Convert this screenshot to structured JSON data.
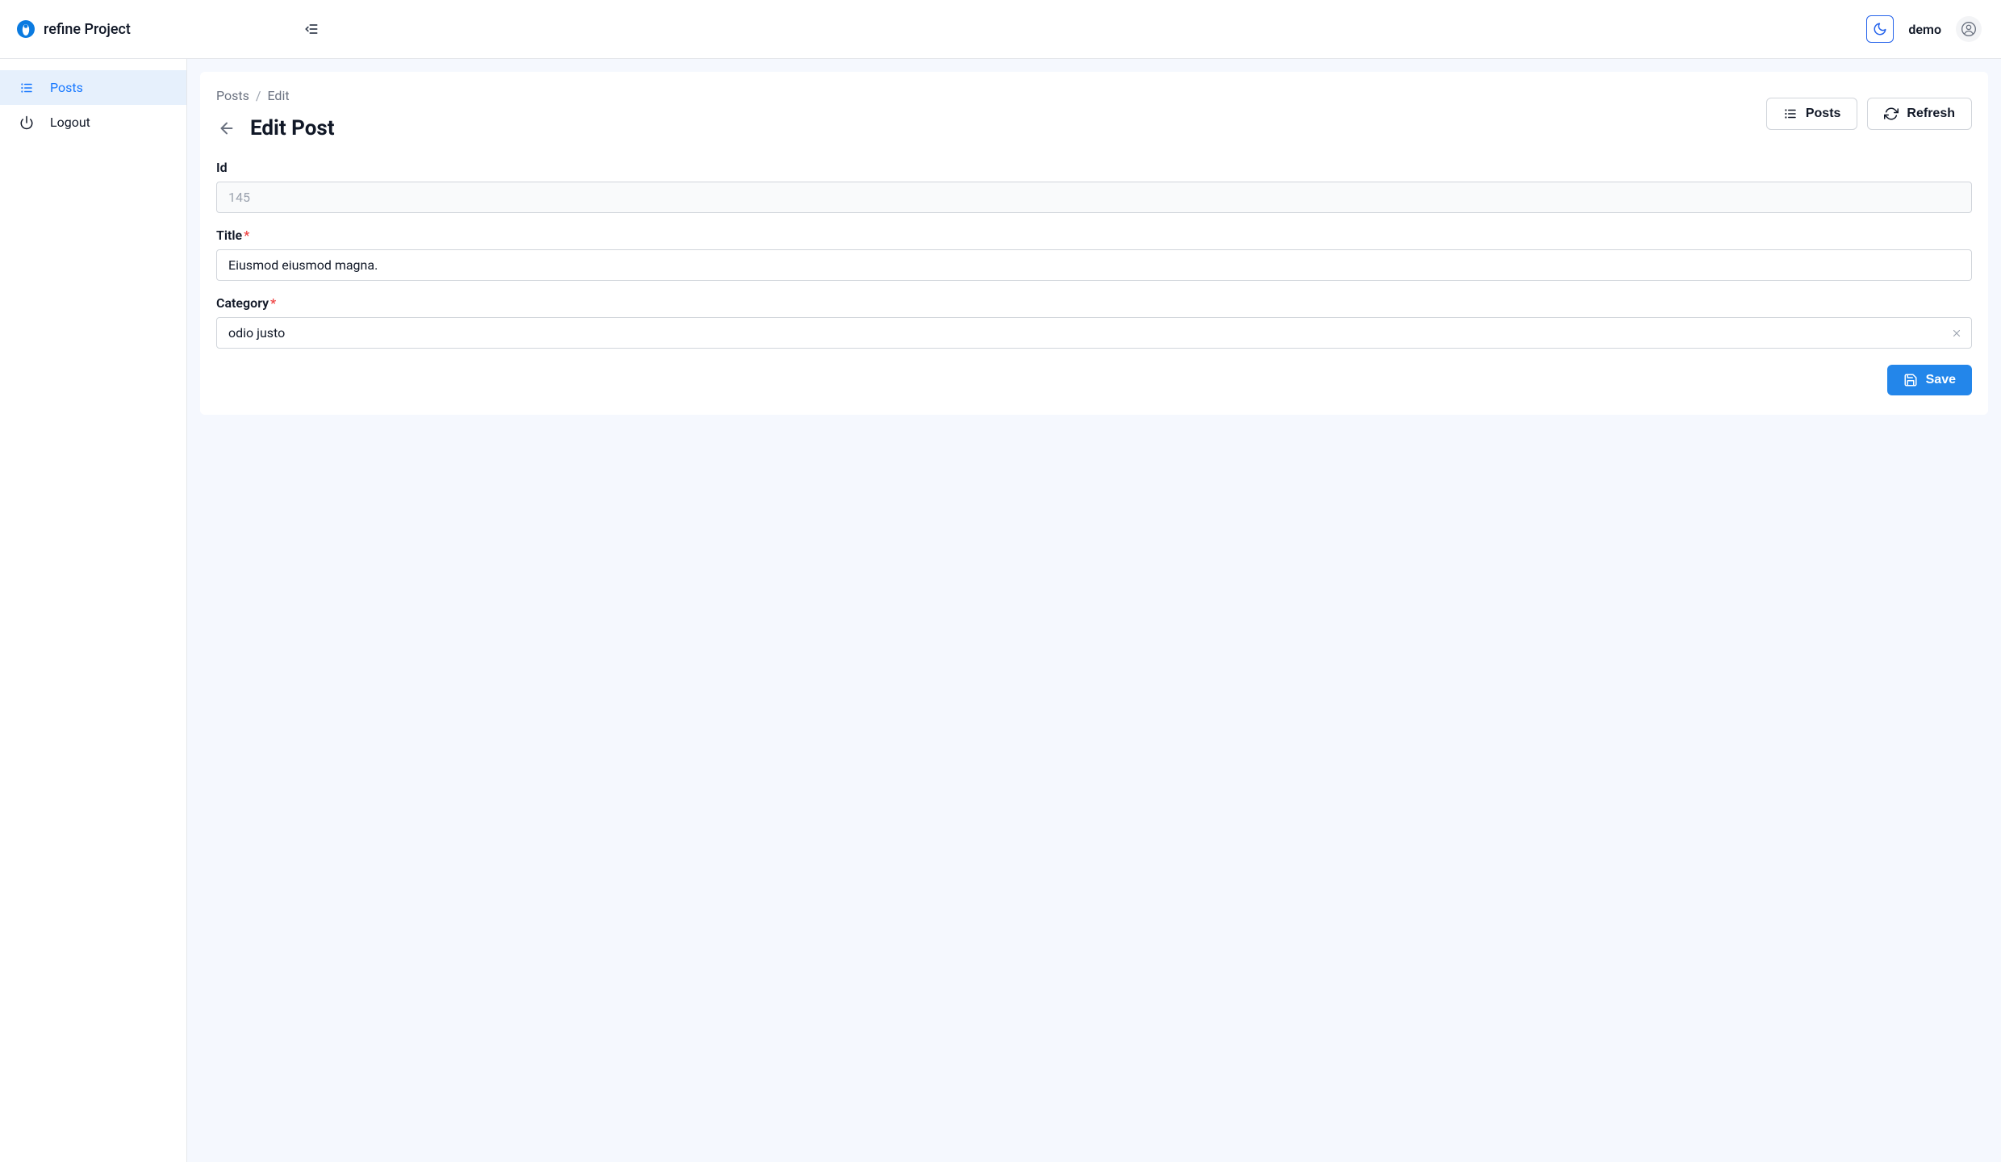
{
  "header": {
    "brand": "refine Project",
    "username": "demo"
  },
  "sidebar": {
    "items": [
      {
        "label": "Posts",
        "active": true
      },
      {
        "label": "Logout",
        "active": false
      }
    ]
  },
  "breadcrumb": {
    "items": [
      "Posts",
      "Edit"
    ]
  },
  "page": {
    "title": "Edit Post"
  },
  "actions": {
    "posts_label": "Posts",
    "refresh_label": "Refresh",
    "save_label": "Save"
  },
  "form": {
    "id": {
      "label": "Id",
      "value": "145"
    },
    "title": {
      "label": "Title",
      "value": "Eiusmod eiusmod magna.",
      "required": true
    },
    "category": {
      "label": "Category",
      "value": "odio justo",
      "required": true
    }
  }
}
